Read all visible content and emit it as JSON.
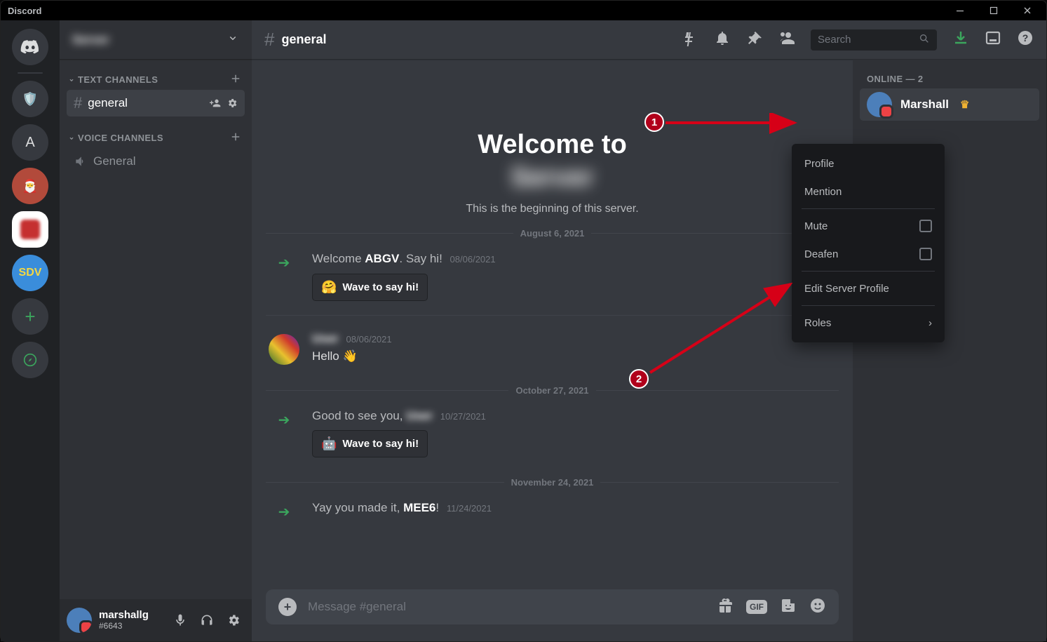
{
  "titlebar": {
    "app_name": "Discord"
  },
  "servers": {
    "item_letter": "A",
    "sdv_label": "SDV"
  },
  "sidebar": {
    "server_name": "Server",
    "cat_text": "TEXT CHANNELS",
    "cat_voice": "VOICE CHANNELS",
    "text_channel": "general",
    "voice_channel": "General"
  },
  "user_panel": {
    "name": "marshallg",
    "tag": "#6643"
  },
  "header": {
    "channel": "general",
    "search_placeholder": "Search"
  },
  "welcome": {
    "title": "Welcome to",
    "server_name": "Server",
    "sub": "This is the beginning of this server."
  },
  "dividers": {
    "d1": "August 6, 2021",
    "d2": "October 27, 2021",
    "d3": "November 24, 2021"
  },
  "messages": {
    "m1_pre": "Welcome ",
    "m1_user": "ABGV",
    "m1_post": ". Say hi!",
    "m1_ts": "08/06/2021",
    "wave_label": "Wave to say hi!",
    "m2_user": "User",
    "m2_ts": "08/06/2021",
    "m2_text": "Hello ",
    "m3_pre": "Good to see you, ",
    "m3_user": "User",
    "m3_ts": "10/27/2021",
    "m4_pre": "Yay you made it, ",
    "m4_user": "MEE6",
    "m4_post": "!",
    "m4_ts": "11/24/2021"
  },
  "composer": {
    "placeholder": "Message #general",
    "gif": "GIF"
  },
  "members": {
    "header": "ONLINE — 2",
    "member1": "Marshall"
  },
  "context_menu": {
    "profile": "Profile",
    "mention": "Mention",
    "mute": "Mute",
    "deafen": "Deafen",
    "edit": "Edit Server Profile",
    "roles": "Roles"
  },
  "callouts": {
    "c1": "1",
    "c2": "2"
  }
}
